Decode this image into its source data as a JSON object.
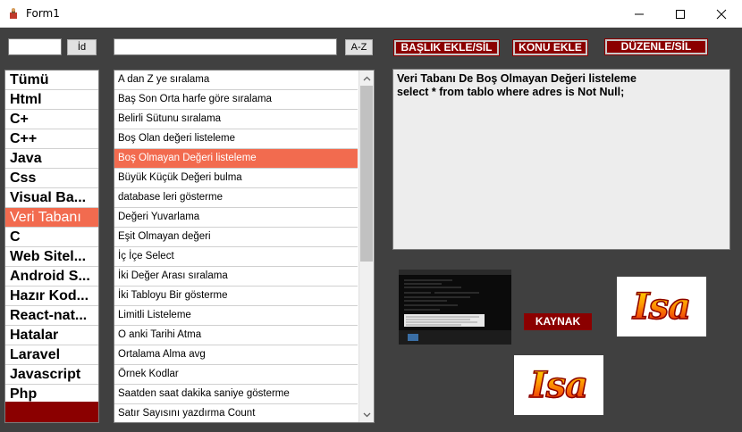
{
  "window": {
    "title": "Form1"
  },
  "toolbar": {
    "id_value": "",
    "id_button": "İd",
    "search_value": "",
    "az_button": "A-Z",
    "add_title_button": "BAŞLIK EKLE/SİL",
    "add_topic_button": "KONU EKLE",
    "edit_button": "DÜZENLE/SİL"
  },
  "categories": {
    "items": [
      "Tümü",
      "Html",
      "C+",
      "C++",
      "Java",
      "Css",
      "Visual Ba...",
      "Veri Tabanı",
      "C",
      "Web Sitel...",
      "Android S...",
      "Hazır Kod...",
      "React-nat...",
      "Hatalar",
      "Laravel",
      "Javascript",
      "Php"
    ],
    "selected": "Veri Tabanı"
  },
  "topics": {
    "items": [
      "A dan Z ye sıralama",
      "Baş Son Orta harfe göre sıralama",
      "Belirli Sütunu sıralama",
      "Boş Olan değeri listeleme",
      "Boş Olmayan Değeri listeleme",
      "Büyük Küçük Değeri bulma",
      "database leri gösterme",
      "Değeri Yuvarlama",
      "Eşit Olmayan değeri",
      "İç İçe Select",
      "İki Değer Arası sıralama",
      "İki Tabloyu Bir gösterme",
      "Limitli Listeleme",
      "O anki Tarihi Atma",
      "Ortalama Alma avg",
      "Örnek Kodlar",
      "Saatden saat dakika saniye gösterme",
      "Satır Sayısını yazdırma Count"
    ],
    "selected": "Boş Olmayan Değeri listeleme"
  },
  "detail": {
    "line1": "Veri Tabanı De Boş Olmayan Değeri listeleme",
    "line2": "select * from tablo where adres is Not Null;"
  },
  "source": {
    "kaynak_button": "KAYNAK",
    "logo_text": "Isa"
  },
  "colors": {
    "background": "#404040",
    "accent_red": "#8b0000",
    "selection": "#f26b4f"
  }
}
